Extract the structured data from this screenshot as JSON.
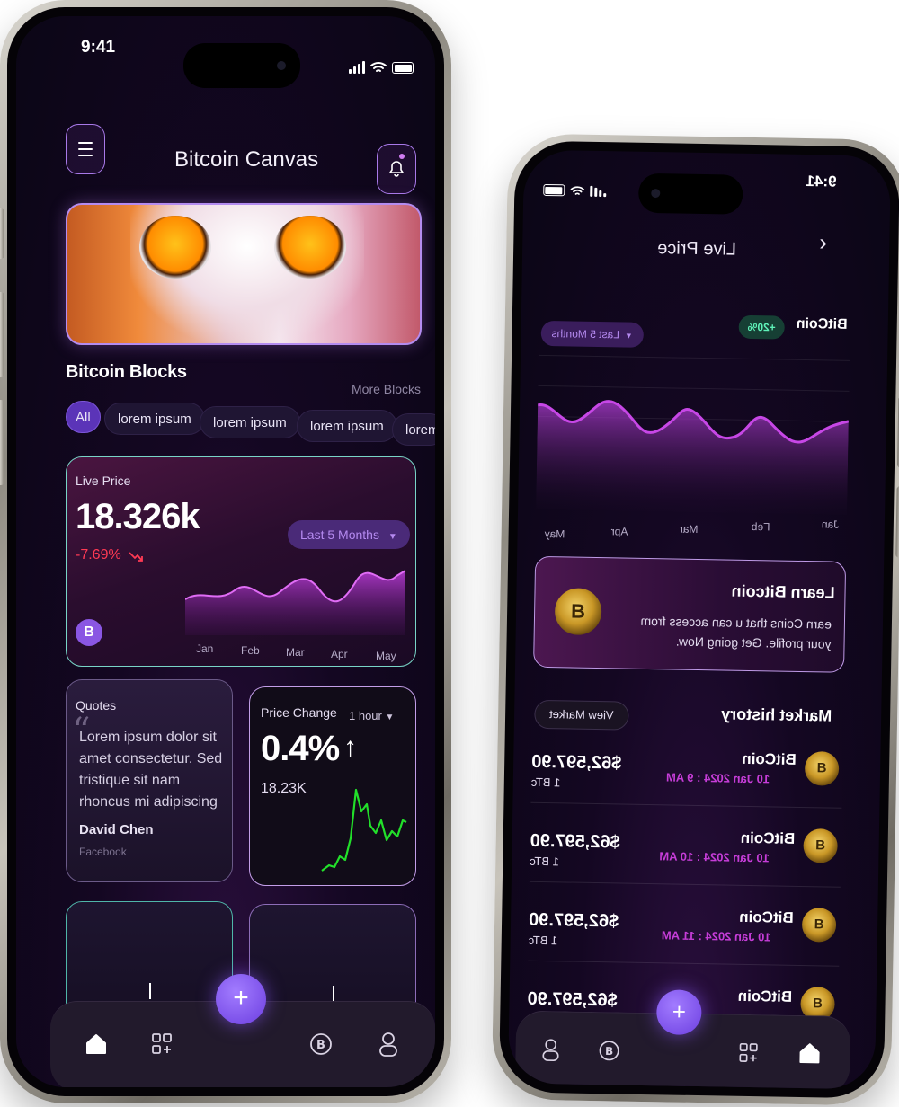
{
  "left": {
    "status": {
      "time": "9:41"
    },
    "header": {
      "title": "Bitcoin Canvas"
    },
    "blocks": {
      "title": "Bitcoin Blocks",
      "more": "More Blocks",
      "chips": [
        "All",
        "lorem ipsum",
        "lorem ipsum",
        "lorem ipsum",
        "lorem"
      ]
    },
    "live_price": {
      "label": "Live Price",
      "value": "18.326k",
      "change": "-7.69%",
      "range": "Last 5 Months",
      "coin_symbol": "B",
      "months": [
        "Jan",
        "Feb",
        "Mar",
        "Apr",
        "May"
      ]
    },
    "quotes": {
      "label": "Quotes",
      "text": "Lorem ipsum dolor sit amet consectetur. Sed tristique sit nam rhoncus mi adipiscing",
      "author": "David Chen",
      "source": "Facebook"
    },
    "price_change": {
      "label": "Price Change",
      "interval": "1 hour",
      "value": "0.4%",
      "arrow": "↑",
      "amount": "18.23K"
    },
    "fab": "+"
  },
  "right": {
    "status": {
      "time": "9:41"
    },
    "header": {
      "back": "‹",
      "title": "Live Price"
    },
    "coin_label": "BitCoin",
    "change_badge": "+20%",
    "range": "Last 5 Months",
    "months": [
      "Jan",
      "Feb",
      "Mar",
      "Apr",
      "May"
    ],
    "learn": {
      "title": "Learn Bitcoin",
      "text": "earn Coins that u can access from your profile. Get going Now."
    },
    "market": {
      "title": "Market history",
      "view": "View Market",
      "rows": [
        {
          "name": "BitCoin",
          "date": "10 Jan 2024 : 9 AM",
          "price": "$62,597.90",
          "qty": "1 BTc"
        },
        {
          "name": "BitCoin",
          "date": "10 Jan 2024 : 10 AM",
          "price": "$62,597.90",
          "qty": "1 BTc"
        },
        {
          "name": "BitCoin",
          "date": "10 Jan 2024 : 11 AM",
          "price": "$62,597.90",
          "qty": "1 BTc"
        },
        {
          "name": "BitCoin",
          "date": "",
          "price": "$62,597.90",
          "qty": ""
        }
      ]
    },
    "fab": "+"
  },
  "colors": {
    "accent": "#8a56e3",
    "negative": "#ff3a54",
    "positive": "#5ff2b9",
    "chart_purple": "#b43fd9",
    "spark_green": "#22e02a"
  }
}
